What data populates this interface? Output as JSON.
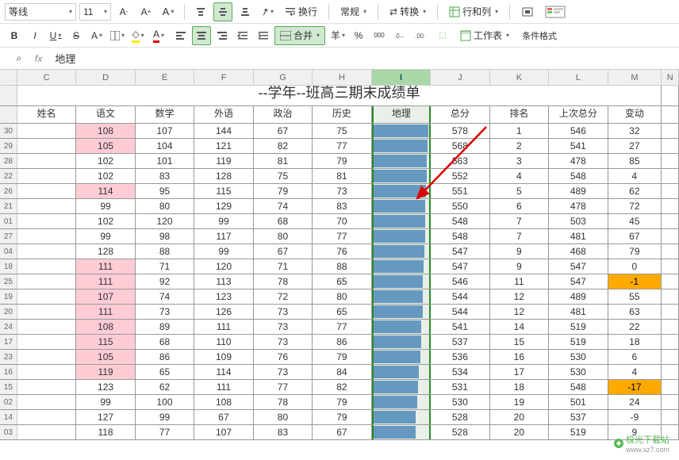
{
  "toolbar": {
    "font_name": "等线",
    "font_size": "11",
    "inc_font": "A+",
    "dec_font": "A-",
    "wrap_label": "换行",
    "merge_label": "合并",
    "number_format": "常规",
    "convert_label": "转换",
    "rowcol_label": "行和列",
    "worksheet_label": "工作表",
    "cond_fmt_label": "条件格式",
    "currency_sym": "羊",
    "percent_sym": "%"
  },
  "formula_bar": {
    "search_icon": "⌕",
    "fx": "fx",
    "value": "地理"
  },
  "columns": [
    "C",
    "D",
    "E",
    "F",
    "G",
    "H",
    "I",
    "J",
    "K",
    "L",
    "M",
    "N"
  ],
  "selected_col": "I",
  "title": "--学年--班高三期末成绩单",
  "headers": [
    "姓名",
    "语文",
    "数学",
    "外语",
    "政治",
    "历史",
    "地理",
    "总分",
    "排名",
    "上次总分",
    "变动"
  ],
  "rows": [
    {
      "r": "30",
      "c": [
        "",
        "108",
        "107",
        "144",
        "67",
        "75",
        "",
        "578",
        "1",
        "546",
        "32"
      ],
      "pink": [
        1
      ],
      "bar": 98
    },
    {
      "r": "29",
      "c": [
        "",
        "105",
        "104",
        "121",
        "82",
        "77",
        "",
        "568",
        "2",
        "541",
        "27"
      ],
      "pink": [
        1
      ],
      "bar": 97
    },
    {
      "r": "28",
      "c": [
        "",
        "102",
        "101",
        "119",
        "81",
        "79",
        "",
        "563",
        "3",
        "478",
        "85"
      ],
      "pink": [],
      "bar": 96
    },
    {
      "r": "22",
      "c": [
        "",
        "102",
        "83",
        "128",
        "75",
        "81",
        "",
        "552",
        "4",
        "548",
        "4"
      ],
      "pink": [],
      "bar": 95
    },
    {
      "r": "26",
      "c": [
        "",
        "114",
        "95",
        "115",
        "79",
        "73",
        "",
        "551",
        "5",
        "489",
        "62"
      ],
      "pink": [
        1
      ],
      "bar": 94
    },
    {
      "r": "21",
      "c": [
        "",
        "99",
        "80",
        "129",
        "74",
        "83",
        "",
        "550",
        "6",
        "478",
        "72"
      ],
      "pink": [],
      "bar": 93
    },
    {
      "r": "01",
      "c": [
        "",
        "102",
        "120",
        "99",
        "68",
        "70",
        "",
        "548",
        "7",
        "503",
        "45"
      ],
      "pink": [],
      "bar": 92
    },
    {
      "r": "27",
      "c": [
        "",
        "99",
        "98",
        "117",
        "80",
        "77",
        "",
        "548",
        "7",
        "481",
        "67"
      ],
      "pink": [],
      "bar": 92
    },
    {
      "r": "04",
      "c": [
        "",
        "128",
        "88",
        "99",
        "67",
        "76",
        "",
        "547",
        "9",
        "468",
        "79"
      ],
      "pink": [],
      "bar": 91
    },
    {
      "r": "18",
      "c": [
        "",
        "111",
        "71",
        "120",
        "71",
        "88",
        "",
        "547",
        "9",
        "547",
        "0"
      ],
      "pink": [
        1
      ],
      "bar": 90
    },
    {
      "r": "25",
      "c": [
        "",
        "111",
        "92",
        "113",
        "78",
        "65",
        "",
        "546",
        "11",
        "547",
        "-1"
      ],
      "pink": [
        1
      ],
      "bar": 89,
      "orange": [
        10
      ]
    },
    {
      "r": "19",
      "c": [
        "",
        "107",
        "74",
        "123",
        "72",
        "80",
        "",
        "544",
        "12",
        "489",
        "55"
      ],
      "pink": [
        1
      ],
      "bar": 88
    },
    {
      "r": "20",
      "c": [
        "",
        "111",
        "73",
        "126",
        "73",
        "65",
        "",
        "544",
        "12",
        "481",
        "63"
      ],
      "pink": [
        1
      ],
      "bar": 88
    },
    {
      "r": "24",
      "c": [
        "",
        "108",
        "89",
        "111",
        "73",
        "77",
        "",
        "541",
        "14",
        "519",
        "22"
      ],
      "pink": [
        1
      ],
      "bar": 86
    },
    {
      "r": "17",
      "c": [
        "",
        "115",
        "68",
        "110",
        "73",
        "86",
        "",
        "537",
        "15",
        "519",
        "18"
      ],
      "pink": [
        1
      ],
      "bar": 85
    },
    {
      "r": "23",
      "c": [
        "",
        "105",
        "86",
        "109",
        "76",
        "79",
        "",
        "536",
        "16",
        "530",
        "6"
      ],
      "pink": [
        1
      ],
      "bar": 84
    },
    {
      "r": "16",
      "c": [
        "",
        "119",
        "65",
        "114",
        "73",
        "84",
        "",
        "534",
        "17",
        "530",
        "4"
      ],
      "pink": [
        1
      ],
      "bar": 82
    },
    {
      "r": "15",
      "c": [
        "",
        "123",
        "62",
        "111",
        "77",
        "82",
        "",
        "531",
        "18",
        "548",
        "-17"
      ],
      "pink": [],
      "bar": 80,
      "orange": [
        10
      ]
    },
    {
      "r": "02",
      "c": [
        "",
        "99",
        "100",
        "108",
        "78",
        "79",
        "",
        "530",
        "19",
        "501",
        "24"
      ],
      "pink": [],
      "bar": 78
    },
    {
      "r": "14",
      "c": [
        "",
        "127",
        "99",
        "67",
        "80",
        "79",
        "",
        "528",
        "20",
        "537",
        "-9"
      ],
      "pink": [],
      "bar": 76
    },
    {
      "r": "03",
      "c": [
        "",
        "118",
        "77",
        "107",
        "83",
        "67",
        "",
        "528",
        "20",
        "519",
        "9"
      ],
      "pink": [],
      "bar": 76
    }
  ],
  "watermark": "极光下载站",
  "watermark_url": "www.xz7.com"
}
